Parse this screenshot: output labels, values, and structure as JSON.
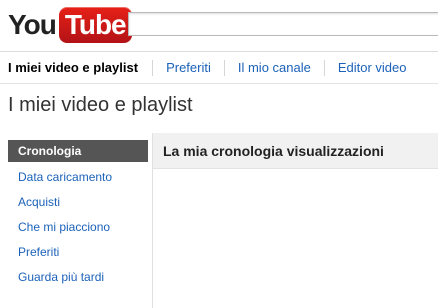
{
  "logo": {
    "you": "You",
    "tube": "Tube"
  },
  "search": {
    "value": ""
  },
  "nav": {
    "items": [
      "I miei video e playlist",
      "Preferiti",
      "Il mio canale",
      "Editor video"
    ]
  },
  "page": {
    "title": "I miei video e playlist"
  },
  "sidebar": {
    "items": [
      "Cronologia",
      "Data caricamento",
      "Acquisti",
      "Che mi piacciono",
      "Preferiti",
      "Guarda più tardi"
    ]
  },
  "content": {
    "title": "La mia cronologia visualizzazioni"
  },
  "colors": {
    "link": "#1c62b9",
    "active_bg": "#555555",
    "brand_red": "#e62117"
  }
}
